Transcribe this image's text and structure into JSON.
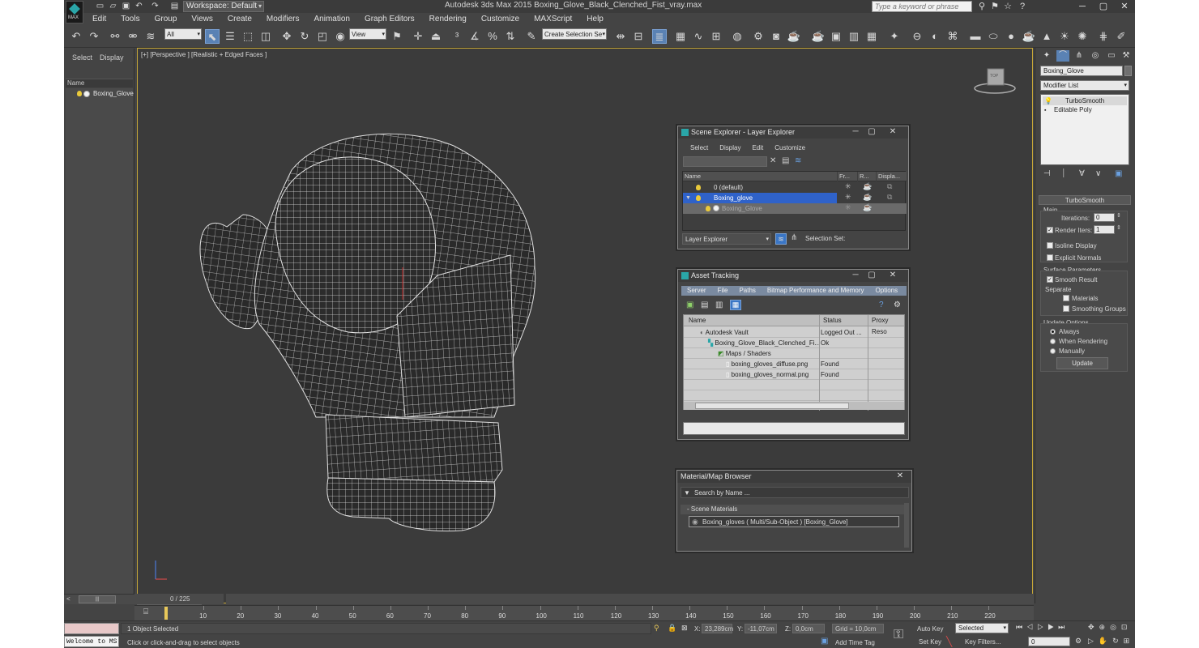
{
  "app": {
    "logo_label": "MAX",
    "window_title": "Autodesk 3ds Max  2015    Boxing_Glove_Black_Clenched_Fist_vray.max",
    "workspace_label": "Workspace: Default",
    "search_placeholder": "Type a keyword or phrase"
  },
  "menu": [
    "Edit",
    "Tools",
    "Group",
    "Views",
    "Create",
    "Modifiers",
    "Animation",
    "Graph Editors",
    "Rendering",
    "Customize",
    "MAXScript",
    "Help"
  ],
  "toolbar": {
    "selection_filter": "All",
    "ref_coord": "View",
    "named_selection": "Create Selection Se"
  },
  "left_panel": {
    "tabs": [
      "Select",
      "Display"
    ],
    "column_header": "Name",
    "items": [
      "Boxing_Glove"
    ]
  },
  "viewport": {
    "label": "[+] [Perspective ] [Realistic + Edged Faces ]",
    "viewcube_label": "TOP"
  },
  "scene_explorer": {
    "title": "Scene Explorer - Layer Explorer",
    "menu": [
      "Select",
      "Display",
      "Edit",
      "Customize"
    ],
    "columns": [
      "Name",
      "Fr...",
      "R...",
      "Displa..."
    ],
    "rows": [
      {
        "name": "0 (default)"
      },
      {
        "name": "Boxing_glove"
      },
      {
        "name": "Boxing_Glove"
      }
    ],
    "footer_dropdown": "Layer Explorer",
    "selection_set_label": "Selection Set:"
  },
  "asset_tracking": {
    "title": "Asset Tracking",
    "menu": [
      "Server",
      "File",
      "Paths",
      "Bitmap Performance and Memory",
      "Options"
    ],
    "columns": [
      "Name",
      "Status",
      "Proxy Reso"
    ],
    "rows": [
      {
        "name": "Autodesk Vault",
        "status": "Logged Out ..."
      },
      {
        "name": "Boxing_Glove_Black_Clenched_Fi...",
        "status": "Ok"
      },
      {
        "name": "Maps / Shaders",
        "status": ""
      },
      {
        "name": "boxing_gloves_diffuse.png",
        "status": "Found"
      },
      {
        "name": "boxing_gloves_normal.png",
        "status": "Found"
      }
    ]
  },
  "material_browser": {
    "title": "Material/Map Browser",
    "search_placeholder": "Search by Name ...",
    "group_label": "- Scene Materials",
    "item": "Boxing_gloves  ( Multi/Sub-Object ) [Boxing_Glove]"
  },
  "command_panel": {
    "object_name": "Boxing_Glove",
    "modifier_list": "Modifier List",
    "stack": [
      "TurboSmooth",
      "Editable Poly"
    ],
    "rollout_title": "TurboSmooth",
    "main_label": "Main",
    "iterations_label": "Iterations:",
    "iterations_value": "0",
    "render_iters_label": "Render Iters:",
    "render_iters_value": "1",
    "isoline_label": "Isoline Display",
    "explicit_normals_label": "Explicit Normals",
    "surface_params_label": "Surface Parameters",
    "smooth_result_label": "Smooth Result",
    "separate_label": "Separate",
    "materials_label": "Materials",
    "smoothing_groups_label": "Smoothing Groups",
    "update_options_label": "Update Options",
    "always_label": "Always",
    "when_rendering_label": "When Rendering",
    "manually_label": "Manually",
    "update_button": "Update"
  },
  "timeline": {
    "frame_counter": "0 / 225",
    "ticks": [
      "10",
      "20",
      "30",
      "40",
      "50",
      "60",
      "70",
      "80",
      "90",
      "100",
      "110",
      "120",
      "130",
      "140",
      "150",
      "160",
      "170",
      "180",
      "190",
      "200",
      "210",
      "220"
    ]
  },
  "status": {
    "welcome": "Welcome to MS",
    "selected_count": "1 Object Selected",
    "prompt": "Click or click-and-drag to select objects",
    "x_label": "X:",
    "x_value": "23,289cm",
    "y_label": "Y:",
    "y_value": "-11,07cm",
    "z_label": "Z:",
    "z_value": "0,0cm",
    "grid": "Grid = 10,0cm",
    "add_time_tag": "Add Time Tag",
    "auto_key": "Auto Key",
    "set_key": "Set Key",
    "key_mode": "Selected",
    "key_filters": "Key Filters...",
    "frame_value": "0"
  },
  "colors": {
    "accent_blue": "#2f62c9",
    "viewport_border": "#c8a838",
    "teal": "#2aa6a8"
  }
}
